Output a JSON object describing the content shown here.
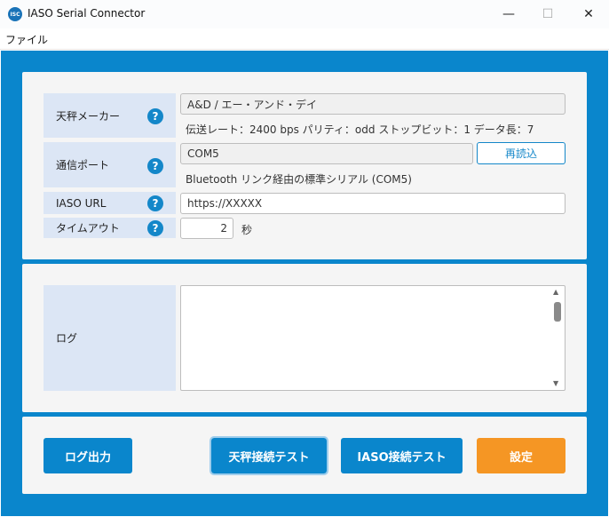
{
  "window": {
    "icon_text": "ISC",
    "title": "IASO Serial Connector",
    "minimize": "—",
    "maximize": "☐",
    "close": "✕"
  },
  "menu": {
    "file": "ファイル"
  },
  "settings": {
    "scale_maker": {
      "label": "天秤メーカー",
      "value": "A&D / エー・アンド・デイ",
      "info": "伝送レート：2400 bps パリティ：odd ストップビット：1 データ長：7"
    },
    "comm_port": {
      "label": "通信ポート",
      "value": "COM5",
      "reload": "再読込",
      "info": "Bluetooth リンク経由の標準シリアル (COM5)"
    },
    "iaso_url": {
      "label": "IASO URL",
      "value": "https://XXXXX"
    },
    "timeout": {
      "label": "タイムアウト",
      "value": "2",
      "unit": "秒"
    },
    "help_glyph": "?"
  },
  "log": {
    "label": "ログ",
    "content": ""
  },
  "buttons": {
    "log_output": "ログ出力",
    "scale_test": "天秤接続テスト",
    "iaso_test": "IASO接続テスト",
    "settings": "設定"
  },
  "colors": {
    "accent": "#0a86cc",
    "label_bg": "#dce6f5",
    "orange": "#f59624"
  }
}
